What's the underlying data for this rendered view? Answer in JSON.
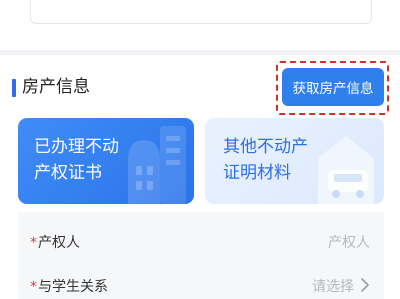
{
  "section": {
    "title": "房产信息",
    "fetch_button": "获取房产信息"
  },
  "cards": [
    {
      "line1": "已办理不动",
      "line2": "产权证书"
    },
    {
      "line1": "其他不动产",
      "line2": "证明材料"
    }
  ],
  "form": {
    "owner": {
      "label": "产权人",
      "placeholder": "产权人"
    },
    "relation": {
      "label": "与学生关系",
      "placeholder": "请选择"
    }
  },
  "colors": {
    "accent": "#2f80ed",
    "required": "#e23c39",
    "highlight_border": "#d0312d"
  }
}
